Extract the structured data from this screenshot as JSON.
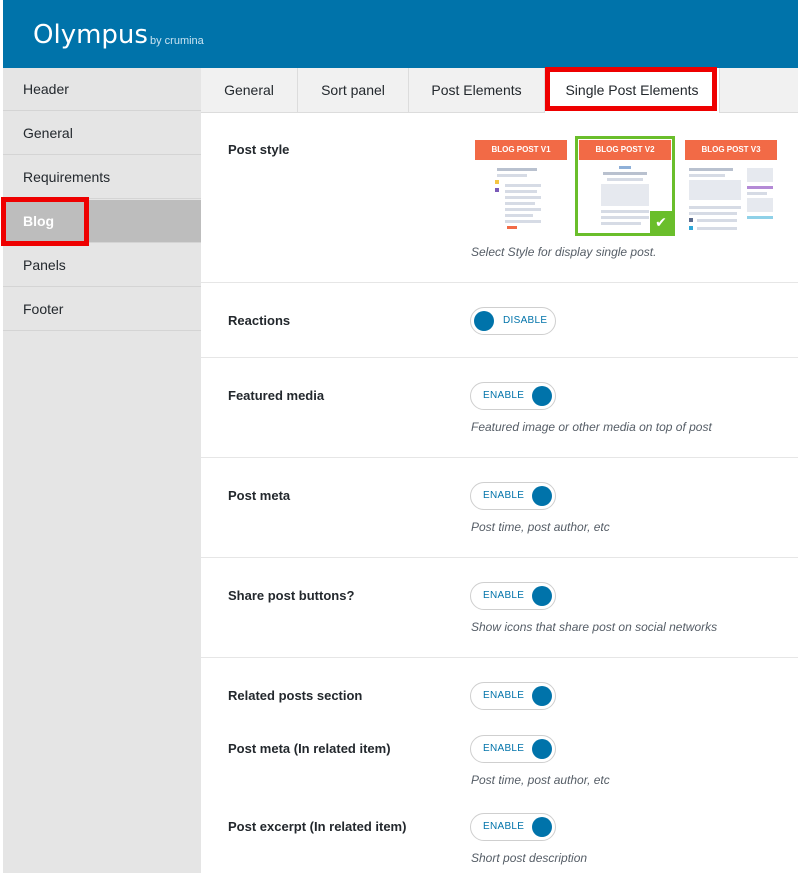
{
  "header": {
    "brand": "Olympus",
    "byline": "by crumina"
  },
  "sidebar": {
    "items": [
      {
        "label": "Header"
      },
      {
        "label": "General"
      },
      {
        "label": "Requirements"
      },
      {
        "label": "Blog"
      },
      {
        "label": "Panels"
      },
      {
        "label": "Footer"
      }
    ]
  },
  "tabs": [
    {
      "label": "General"
    },
    {
      "label": "Sort panel"
    },
    {
      "label": "Post Elements"
    },
    {
      "label": "Single Post Elements"
    }
  ],
  "post_style": {
    "label": "Post style",
    "description": "Select Style for display single post.",
    "options": [
      {
        "label": "BLOG POST V1"
      },
      {
        "label": "BLOG POST V2"
      },
      {
        "label": "BLOG POST V3"
      }
    ],
    "selected": "BLOG POST V2"
  },
  "settings": {
    "reactions": {
      "label": "Reactions",
      "toggle": "DISABLE",
      "state": "off"
    },
    "featured_media": {
      "label": "Featured media",
      "toggle": "ENABLE",
      "state": "on",
      "description": "Featured image or other media on top of post"
    },
    "post_meta": {
      "label": "Post meta",
      "toggle": "ENABLE",
      "state": "on",
      "description": "Post time, post author, etc"
    },
    "share_buttons": {
      "label": "Share post buttons?",
      "toggle": "ENABLE",
      "state": "on",
      "description": "Show icons that share post on social networks"
    },
    "related_posts": {
      "label": "Related posts section",
      "toggle": "ENABLE",
      "state": "on"
    },
    "related_meta": {
      "label": "Post meta (In related item)",
      "toggle": "ENABLE",
      "state": "on",
      "description": "Post time, post author, etc"
    },
    "related_excerpt": {
      "label": "Post excerpt (In related item)",
      "toggle": "ENABLE",
      "state": "on",
      "description": "Short post description"
    }
  },
  "colors": {
    "header_bg": "#0073aa",
    "accent": "#0073aa",
    "highlight": "#ee0000",
    "selected_border": "#6abe2b",
    "thumb_band": "#f26a46"
  }
}
